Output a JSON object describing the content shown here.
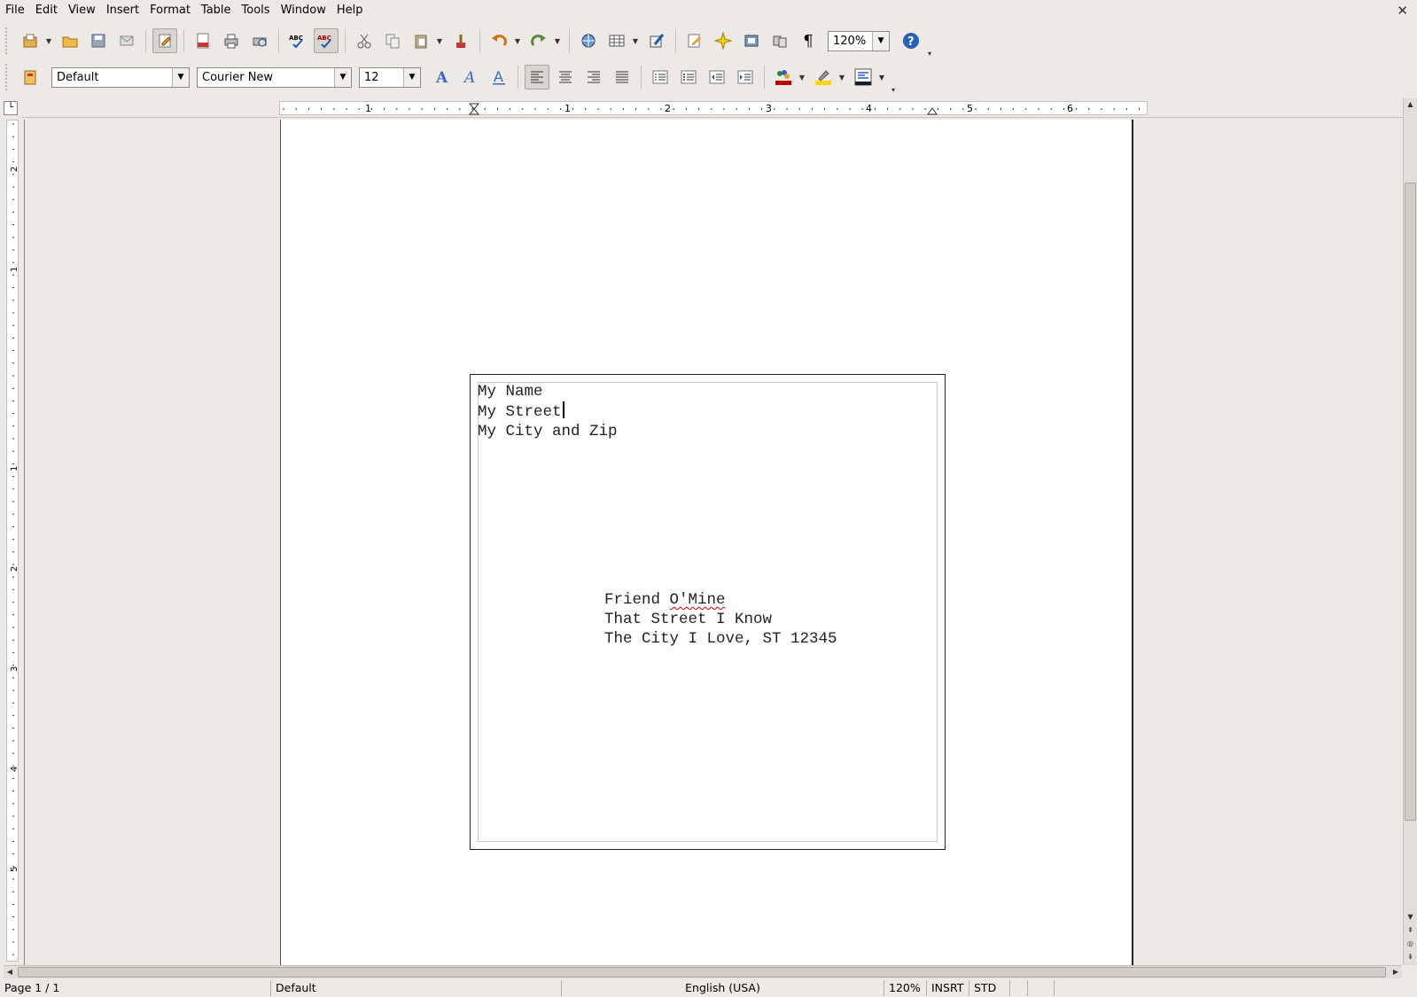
{
  "menu": [
    "File",
    "Edit",
    "View",
    "Insert",
    "Format",
    "Table",
    "Tools",
    "Window",
    "Help"
  ],
  "menu_close": "✕",
  "toolbar_standard": {
    "zoom_value": "120%",
    "formatting_marks_glyph": "¶"
  },
  "toolbar_formatting": {
    "style_value": "Default",
    "font_value": "Courier New",
    "size_value": "12",
    "font_color": "#c00000",
    "highlight_color": "#ffd400"
  },
  "ruler": {
    "h_labels": [
      "1",
      "1",
      "2",
      "3",
      "4",
      "5",
      "6"
    ],
    "v_labels": [
      "2",
      "1",
      "1",
      "2",
      "3",
      "4",
      "5"
    ]
  },
  "document": {
    "sender_lines": [
      "My Name",
      "My Street",
      "My City and Zip"
    ],
    "recipient_lines": {
      "line1_word1": "Friend ",
      "line1_word2": "O'Mine",
      "line2": "That Street I Know",
      "line3": "The City I Love, ST 12345"
    }
  },
  "statusbar": {
    "page": "Page 1 / 1",
    "style": "Default",
    "language": "English (USA)",
    "zoom": "120%",
    "insert_mode": "INSRT",
    "selection_mode": "STD"
  }
}
